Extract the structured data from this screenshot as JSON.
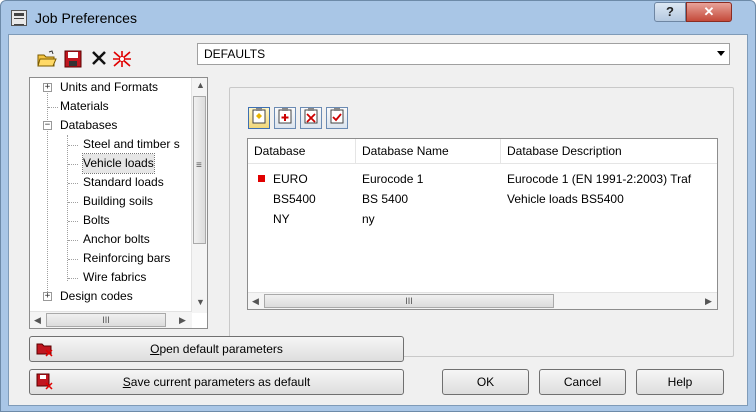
{
  "window": {
    "title": "Job Preferences",
    "help_label": "?",
    "close_label": "✕"
  },
  "toolbar": {
    "tools": [
      "open-folder-icon",
      "save-icon",
      "delete-icon",
      "reset-icon"
    ]
  },
  "profile_combo": {
    "value": "DEFAULTS"
  },
  "tree": {
    "items": [
      {
        "label": "Units and Formats",
        "level": 0,
        "expander": "+"
      },
      {
        "label": "Materials",
        "level": 0,
        "expander": ""
      },
      {
        "label": "Databases",
        "level": 0,
        "expander": "−"
      },
      {
        "label": "Steel and timber s",
        "level": 1,
        "expander": ""
      },
      {
        "label": "Vehicle loads",
        "level": 1,
        "expander": "",
        "selected": true
      },
      {
        "label": "Standard loads",
        "level": 1,
        "expander": ""
      },
      {
        "label": "Building soils",
        "level": 1,
        "expander": ""
      },
      {
        "label": "Bolts",
        "level": 1,
        "expander": ""
      },
      {
        "label": "Anchor bolts",
        "level": 1,
        "expander": ""
      },
      {
        "label": "Reinforcing bars",
        "level": 1,
        "expander": ""
      },
      {
        "label": "Wire fabrics",
        "level": 1,
        "expander": ""
      },
      {
        "label": "Design codes",
        "level": 0,
        "expander": "+"
      }
    ],
    "hscroll_grip": "III",
    "vscroll_grip": "≡"
  },
  "db_toolbar": {
    "icons": [
      "db-select-icon",
      "db-add-icon",
      "db-delete-icon",
      "db-check-icon"
    ]
  },
  "db_list": {
    "columns": [
      "Database",
      "Database Name",
      "Database Description"
    ],
    "rows": [
      {
        "db": "EURO",
        "name": "Eurocode 1",
        "desc": "Eurocode 1 (EN 1991-2:2003) Traf",
        "active": true
      },
      {
        "db": "BS5400",
        "name": "BS 5400",
        "desc": "Vehicle loads BS5400",
        "active": false
      },
      {
        "db": "NY",
        "name": "ny",
        "desc": "",
        "active": false
      }
    ],
    "hscroll_grip": "III"
  },
  "buttons": {
    "open_default": {
      "prefix": "",
      "accel": "O",
      "rest": "pen default parameters"
    },
    "save_default": {
      "prefix": "",
      "accel": "S",
      "rest": "ave current parameters as default"
    },
    "ok": "OK",
    "cancel": "Cancel",
    "help": "Help"
  },
  "colors": {
    "accent_red": "#e00000",
    "titlebar": "#a9c6e6"
  }
}
